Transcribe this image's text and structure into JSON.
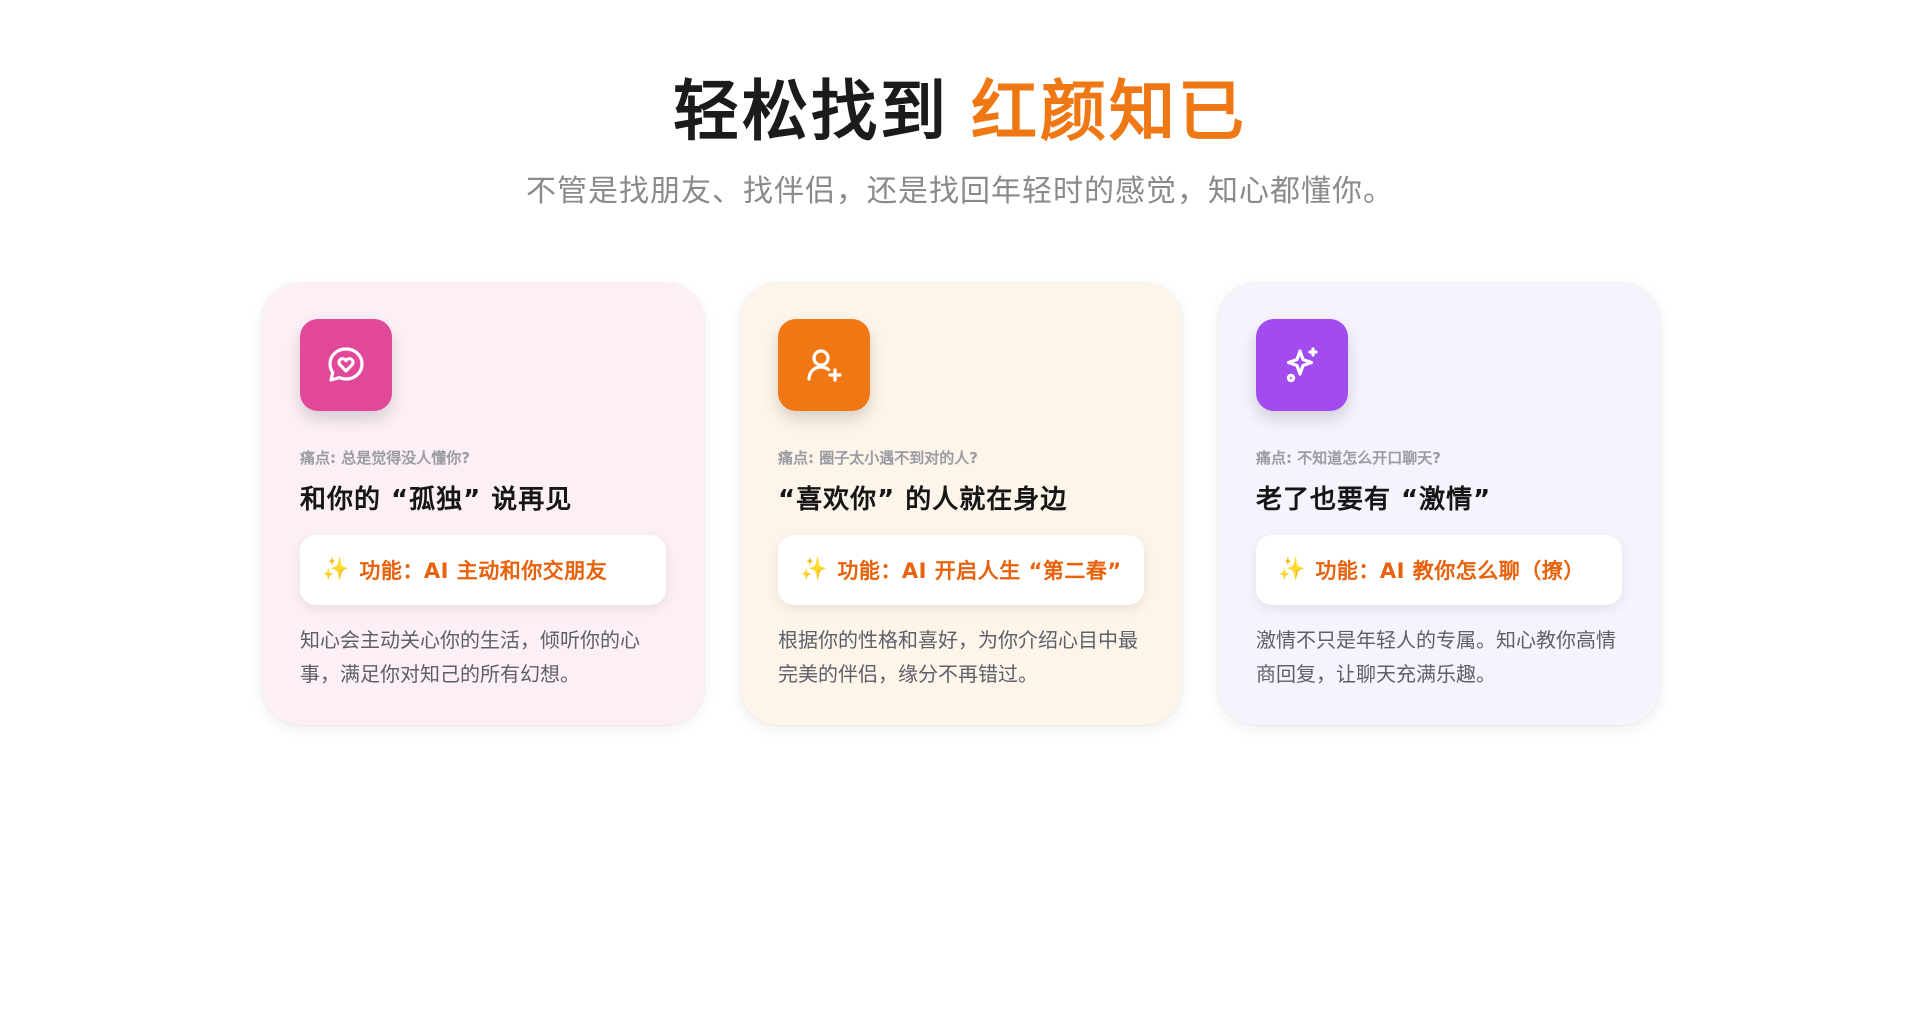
{
  "hero": {
    "title_main": "轻松找到",
    "title_accent": "红颜知已",
    "subtitle": "不管是找朋友、找伴侣，还是找回年轻时的感觉，知心都懂你。"
  },
  "colors": {
    "accent": "#f07814",
    "pink_icon": "#e2489a",
    "orange_icon": "#f07814",
    "purple_icon": "#a24cf0"
  },
  "cards": [
    {
      "icon": "chat-heart-icon",
      "pain": "痛点: 总是觉得没人懂你?",
      "heading": "和你的 “孤独” 说再见",
      "feature": "功能：AI 主动和你交朋友",
      "desc": "知心会主动关心你的生活，倾听你的心事，满足你对知己的所有幻想。"
    },
    {
      "icon": "user-plus-icon",
      "pain": "痛点: 圈子太小遇不到对的人?",
      "heading": "“喜欢你” 的人就在身边",
      "feature": "功能：AI 开启人生 “第二春”",
      "desc": "根据你的性格和喜好，为你介绍心目中最完美的伴侣，缘分不再错过。"
    },
    {
      "icon": "sparkles-icon",
      "pain": "痛点: 不知道怎么开口聊天?",
      "heading": "老了也要有 “激情”",
      "feature": "功能：AI 教你怎么聊（撩）",
      "desc": "激情不只是年轻人的专属。知心教你高情商回复，让聊天充满乐趣。"
    }
  ]
}
